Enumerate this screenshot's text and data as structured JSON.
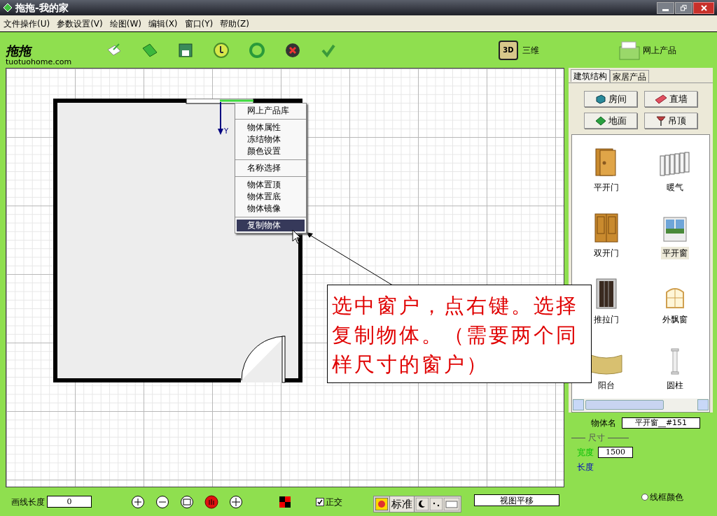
{
  "window": {
    "title": "拖拖-我的家"
  },
  "menu": [
    "文件操作(U)",
    "参数设置(V)",
    "绘图(W)",
    "编辑(X)",
    "窗口(Y)",
    "帮助(Z)"
  ],
  "toolbar": {
    "logo_mark": "拖拖",
    "logo_text": "tuotuohome.com",
    "view_3d": {
      "badge": "3D",
      "label": "三维"
    },
    "online": "网上产品"
  },
  "canvas": {
    "axis_label": "Y",
    "context_menu": [
      [
        {
          "label": "网上产品库",
          "selected": false
        }
      ],
      [
        {
          "label": "物体属性",
          "selected": false
        },
        {
          "label": "冻结物体",
          "selected": false
        },
        {
          "label": "颜色设置",
          "selected": false
        }
      ],
      [
        {
          "label": "名称选择",
          "selected": false
        }
      ],
      [
        {
          "label": "物体置顶",
          "selected": false
        },
        {
          "label": "物体置底",
          "selected": false
        },
        {
          "label": "物体镜像",
          "selected": false
        }
      ],
      [
        {
          "label": "复制物体",
          "selected": true
        }
      ]
    ],
    "callout": "选中窗户，点右键。选择复制物体。（需要两个同样尺寸的窗户）"
  },
  "side_panel": {
    "tabs": [
      {
        "label": "建筑结构",
        "selected": true
      },
      {
        "label": "家居产品",
        "selected": false
      }
    ],
    "buttons": [
      {
        "label": "房间",
        "kind": "room"
      },
      {
        "label": "直墙",
        "kind": "wall"
      },
      {
        "label": "地面",
        "kind": "floor"
      },
      {
        "label": "吊顶",
        "kind": "ceiling"
      }
    ],
    "items": [
      {
        "label": "平开门",
        "kind": "door",
        "selected": false
      },
      {
        "label": "暖气",
        "kind": "radiator",
        "selected": false
      },
      {
        "label": "双开门",
        "kind": "double-door",
        "selected": false
      },
      {
        "label": "平开窗",
        "kind": "window",
        "selected": true
      },
      {
        "label": "推拉门",
        "kind": "sliding-door",
        "selected": false
      },
      {
        "label": "外飘窗",
        "kind": "bay-window",
        "selected": false
      },
      {
        "label": "阳台",
        "kind": "balcony",
        "selected": false
      },
      {
        "label": "圆柱",
        "kind": "column",
        "selected": false
      }
    ],
    "properties": {
      "name_label": "物体名",
      "name_value": "平开窗__#151",
      "section": "尺寸",
      "width_label": "宽度",
      "width_value": "1500",
      "length_label": "长度",
      "wire_color": {
        "label": "线框颜色",
        "selected": false
      }
    }
  },
  "bottom_bar": {
    "line_length_label": "画线长度",
    "line_length_value": "0",
    "ortho": {
      "label": "正交",
      "checked": true
    },
    "ime": {
      "mode": "标准"
    },
    "operation_value": "视图平移"
  }
}
